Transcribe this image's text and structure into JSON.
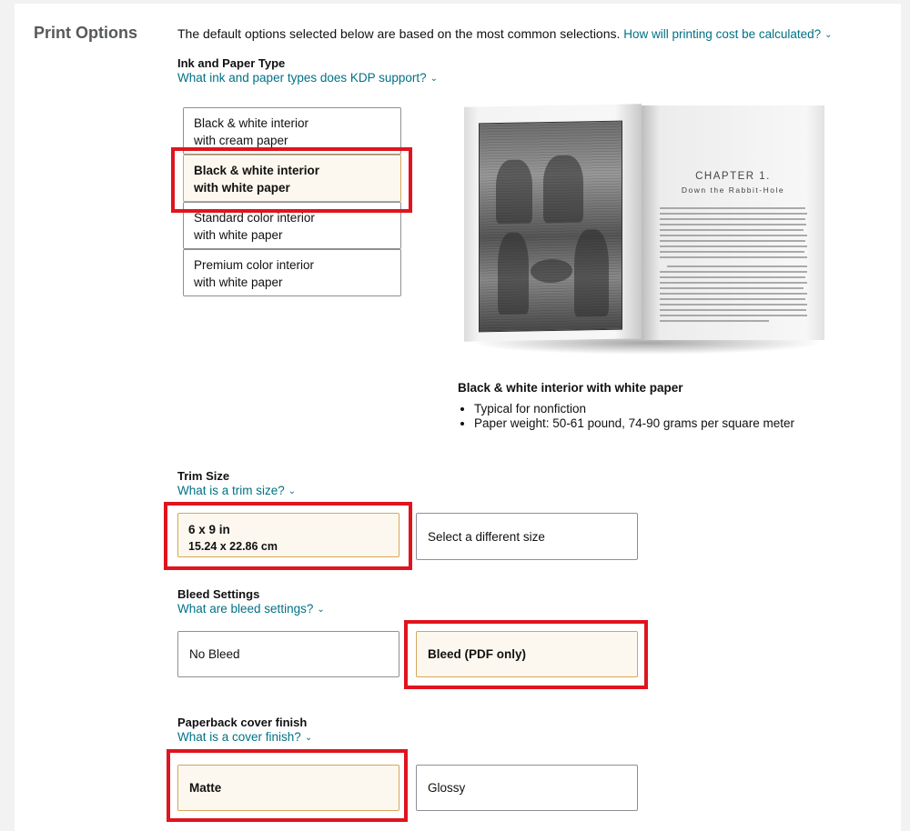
{
  "section_title": "Print Options",
  "intro": {
    "text": "The default options selected below are based on the most common selections.",
    "link": "How will printing cost be calculated?"
  },
  "ink_paper": {
    "label": "Ink and Paper Type",
    "help_link": "What ink and paper types does KDP support?",
    "options": [
      {
        "line1": "Black & white interior",
        "line2": "with cream paper",
        "selected": false
      },
      {
        "line1": "Black & white interior",
        "line2": "with white paper",
        "selected": true
      },
      {
        "line1": "Standard color interior",
        "line2": "with white paper",
        "selected": false
      },
      {
        "line1": "Premium color interior",
        "line2": "with white paper",
        "selected": false
      }
    ],
    "preview": {
      "chapter_heading": "CHAPTER 1.",
      "chapter_subtitle": "Down the Rabbit-Hole",
      "caption": "Black & white interior with white paper",
      "bullets": [
        "Typical for nonfiction",
        "Paper weight: 50-61 pound, 74-90 grams per square meter"
      ]
    }
  },
  "trim_size": {
    "label": "Trim Size",
    "help_link": "What is a trim size?",
    "selected_size": "6 x 9 in",
    "selected_size_metric": "15.24 x 22.86 cm",
    "other_option": "Select a different size"
  },
  "bleed": {
    "label": "Bleed Settings",
    "help_link": "What are bleed settings?",
    "options": [
      "No Bleed",
      "Bleed (PDF only)"
    ],
    "selected": "Bleed (PDF only)"
  },
  "cover_finish": {
    "label": "Paperback cover finish",
    "help_link": "What is a cover finish?",
    "options": [
      "Matte",
      "Glossy"
    ],
    "selected": "Matte"
  },
  "colors": {
    "link": "#007185",
    "selected_bg": "#fdf8ef",
    "selected_border": "#d6a65a",
    "highlight": "#e0141e"
  }
}
